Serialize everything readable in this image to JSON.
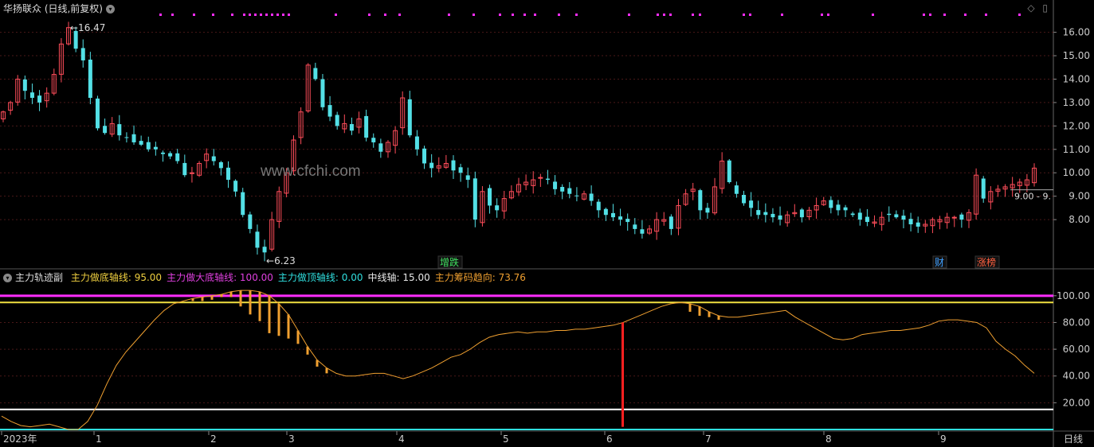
{
  "header": {
    "stock_title": "华扬联众 (日线,前复权)",
    "indicator_name": "主力轨迹副",
    "indicators": [
      {
        "label": "主力做底轴线:",
        "value": "95.00",
        "color": "#f0d040"
      },
      {
        "label": "主力做大底轴线:",
        "value": "100.00",
        "color": "#e040e0"
      },
      {
        "label": "主力做顶轴线:",
        "value": "0.00",
        "color": "#30e0e0"
      },
      {
        "label": "中线轴:",
        "value": "15.00",
        "color": "#e8e8e8"
      },
      {
        "label": "主力筹码趋向:",
        "value": "73.76",
        "color": "#f0a030"
      }
    ]
  },
  "watermark": "www.cfchi.com",
  "colors": {
    "up": "#ff4d5a",
    "down": "#53e0e6",
    "magenta": "#ff2dff",
    "yellow": "#f0e040",
    "white": "#ffffff",
    "cyan": "#30e0e0",
    "orange": "#f0a030",
    "red": "#ff2020",
    "grid": "#4a1818"
  },
  "chart_data": [
    {
      "type": "candlestick",
      "title": "华扬联众 (日线,前复权)",
      "y_ticks": [
        "16.00",
        "15.00",
        "14.00",
        "13.00",
        "12.00",
        "11.00",
        "10.00",
        "9.00",
        "8.00"
      ],
      "ylim": [
        6.0,
        16.7
      ],
      "annotations": [
        {
          "text": "16.47",
          "type": "high"
        },
        {
          "text": "6.23",
          "type": "low"
        },
        {
          "text": "9.00 - 9.",
          "type": "price_tag"
        }
      ],
      "event_labels": [
        {
          "text": "增跌",
          "color": "#40e060"
        },
        {
          "text": "财",
          "color": "#40a0ff"
        },
        {
          "text": "涨榜",
          "color": "#ff6040"
        }
      ],
      "x_axis_labels": [
        "2023年",
        "1",
        "2",
        "3",
        "4",
        "5",
        "6",
        "7",
        "8",
        "9"
      ],
      "period_label": "日线",
      "close_series": [
        12.6,
        13.0,
        14.0,
        13.5,
        13.2,
        13.0,
        13.4,
        14.2,
        15.5,
        16.2,
        15.3,
        14.8,
        13.2,
        11.9,
        11.7,
        12.1,
        11.6,
        11.5,
        11.3,
        11.2,
        11.0,
        11.0,
        10.8,
        10.7,
        10.5,
        9.9,
        10.0,
        10.4,
        10.8,
        10.5,
        10.2,
        9.7,
        9.2,
        8.2,
        7.6,
        6.8,
        6.6,
        8.0,
        9.2,
        10.0,
        11.4,
        12.6,
        14.6,
        14.0,
        12.8,
        12.4,
        12.0,
        12.1,
        11.8,
        12.3,
        11.5,
        11.3,
        10.9,
        11.3,
        11.8,
        13.2,
        11.6,
        11.0,
        10.4,
        10.2,
        10.3,
        10.4,
        10.1,
        10.0,
        9.7,
        8.0,
        9.2,
        8.6,
        8.4,
        8.9,
        9.2,
        9.5,
        9.6,
        9.7,
        9.8,
        9.7,
        9.3,
        9.2,
        9.1,
        9.0,
        9.1,
        8.8,
        8.4,
        8.2,
        8.1,
        8.0,
        7.9,
        7.6,
        7.4,
        7.6,
        8.0,
        8.0,
        7.6,
        8.6,
        9.1,
        9.3,
        8.4,
        8.3,
        9.4,
        10.5,
        9.6,
        9.1,
        8.7,
        8.5,
        8.2,
        8.2,
        8.1,
        8.0,
        8.2,
        8.3,
        8.1,
        8.4,
        8.6,
        8.8,
        8.5,
        8.4,
        8.4,
        8.2,
        8.0,
        7.9,
        7.9,
        8.1,
        8.2,
        8.1,
        8.0,
        7.8,
        7.7,
        7.8,
        8.0,
        8.0,
        8.1,
        8.1,
        8.0,
        8.3,
        9.9,
        8.9,
        9.2,
        9.3,
        9.4,
        9.5,
        9.6,
        9.7,
        10.2
      ]
    },
    {
      "type": "line",
      "title": "主力轨迹副",
      "y_ticks": [
        "100.00",
        "80.00",
        "60.00",
        "40.00",
        "20.00"
      ],
      "ylim": [
        0,
        110
      ],
      "series": [
        {
          "name": "主力做底轴线",
          "value": 95.0,
          "color": "#f0e040"
        },
        {
          "name": "主力做大底轴线",
          "value": 100.0,
          "color": "#ff2dff"
        },
        {
          "name": "主力做顶轴线",
          "value": 0.0,
          "color": "#30e0e0"
        },
        {
          "name": "中线轴",
          "value": 15.0,
          "color": "#ffffff"
        },
        {
          "name": "主力筹码趋向",
          "color": "#f0a030",
          "values": [
            10,
            6,
            3,
            2,
            3,
            4,
            2,
            0,
            0,
            6,
            18,
            34,
            48,
            58,
            66,
            74,
            82,
            89,
            94,
            96,
            98,
            99,
            100,
            101,
            103,
            104,
            104,
            103,
            100,
            94,
            86,
            74,
            62,
            52,
            46,
            42,
            40,
            40,
            41,
            42,
            42,
            40,
            38,
            40,
            43,
            46,
            50,
            54,
            56,
            60,
            65,
            69,
            71,
            72,
            73,
            72,
            73,
            73,
            74,
            74,
            75,
            75,
            76,
            77,
            78,
            80,
            83,
            86,
            89,
            92,
            94,
            95,
            94,
            92,
            88,
            85,
            84,
            84,
            85,
            86,
            87,
            88,
            89,
            84,
            80,
            76,
            72,
            68,
            67,
            68,
            71,
            72,
            73,
            74,
            74,
            75,
            76,
            78,
            81,
            82,
            82,
            81,
            80,
            76,
            66,
            60,
            55,
            48,
            42
          ]
        },
        {
          "name": "主力筹码趋向柱",
          "type": "bar",
          "color": "#f0a030",
          "values": [
            0,
            0,
            0,
            0,
            0,
            0,
            0,
            0,
            0,
            0,
            0,
            0,
            0,
            0,
            0,
            0,
            0,
            0,
            0,
            0,
            2,
            3,
            3,
            2,
            4,
            12,
            18,
            22,
            28,
            24,
            18,
            10,
            6,
            5,
            4,
            0,
            0,
            0,
            0,
            0,
            0,
            0,
            0,
            0,
            0,
            0,
            0,
            0,
            0,
            0,
            0,
            0,
            0,
            0,
            0,
            0,
            0,
            0,
            0,
            0,
            0,
            0,
            0,
            0,
            0,
            0,
            0,
            0,
            0,
            0,
            0,
            0,
            6,
            7,
            4,
            3,
            0,
            0,
            0,
            0,
            0,
            0,
            0,
            0,
            0,
            0,
            0,
            0,
            0,
            0,
            0,
            0,
            0,
            0,
            0,
            0,
            0,
            0,
            0,
            0,
            0,
            0,
            0,
            0,
            0,
            0,
            0,
            0,
            0
          ]
        }
      ],
      "signal_bar": {
        "value_from": 2,
        "value_to": 80,
        "color": "#ff2020"
      }
    }
  ]
}
